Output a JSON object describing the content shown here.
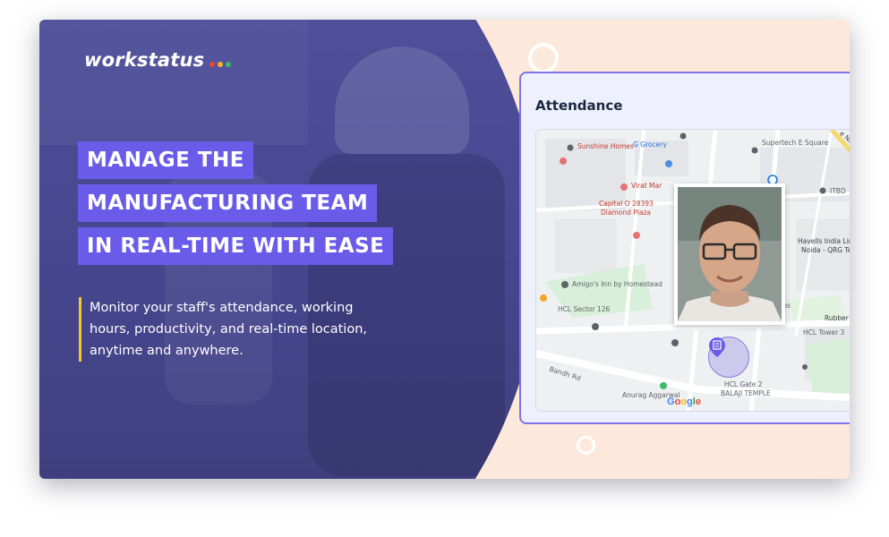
{
  "brand": {
    "name": "workstatus",
    "dot_colors": [
      "#e5483b",
      "#f6b428",
      "#3fb96b"
    ]
  },
  "headline": {
    "lines": [
      "MANAGE THE",
      "MANUFACTURING TEAM",
      "IN REAL-TIME WITH EASE"
    ]
  },
  "description": {
    "lines": [
      "Monitor your staff's attendance, working",
      "hours, productivity, and real-time location,",
      "anytime and anywhere."
    ]
  },
  "attendance": {
    "title": "Attendance",
    "map": {
      "labels": [
        "Sunshine Homes",
        "G Grocery",
        "Supertech E Square",
        "Virat Mar",
        "Capital O 28393",
        "Diamond Plaza",
        "ITBD",
        "Havells India Lim",
        "Noida - QRG Te",
        "Amigo's Inn by Homestead",
        "HCL Sector 126",
        "Rubber",
        "HCL Tower 3",
        "Bandh Rd",
        "Anurag Aggarwal",
        "HCL Gate 2",
        "BALAJI TEMPLE",
        "logies",
        "e No"
      ],
      "attribution": "Google"
    }
  },
  "colors": {
    "left_panel": "#4b4b95",
    "headline_bg": "#6a5ce8",
    "accent_bar": "#f6c82a",
    "card_bg": "#fde9dc",
    "panel_border": "#7f73e6"
  }
}
